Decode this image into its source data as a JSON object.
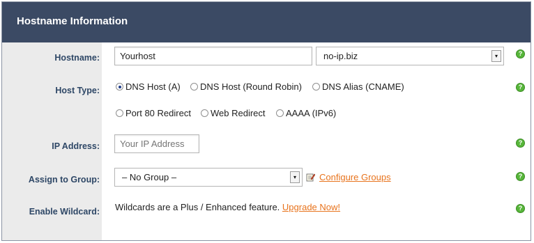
{
  "header": {
    "title": "Hostname Information"
  },
  "rows": {
    "hostname": {
      "label": "Hostname:",
      "value": "Yourhost",
      "domain_select": "no-ip.biz"
    },
    "host_type": {
      "label": "Host Type:",
      "options": [
        "DNS Host (A)",
        "DNS Host (Round Robin)",
        "DNS Alias (CNAME)",
        "Port 80 Redirect",
        "Web Redirect",
        "AAAA (IPv6)"
      ],
      "selected": "DNS Host (A)"
    },
    "ip_address": {
      "label": "IP Address:",
      "placeholder": "Your IP Address"
    },
    "group": {
      "label": "Assign to Group:",
      "select": "– No Group –",
      "configure_link": "Configure Groups"
    },
    "wildcard": {
      "label": "Enable Wildcard:",
      "text": "Wildcards are a Plus / Enhanced feature.",
      "upgrade_link": "Upgrade Now!"
    }
  },
  "help_icon_glyph": "?",
  "select_arrow_glyph": "▾",
  "colors": {
    "header_bg": "#3b4a64",
    "label_text": "#2e4766",
    "link": "#e8731c",
    "help_icon": "#57b63a"
  }
}
